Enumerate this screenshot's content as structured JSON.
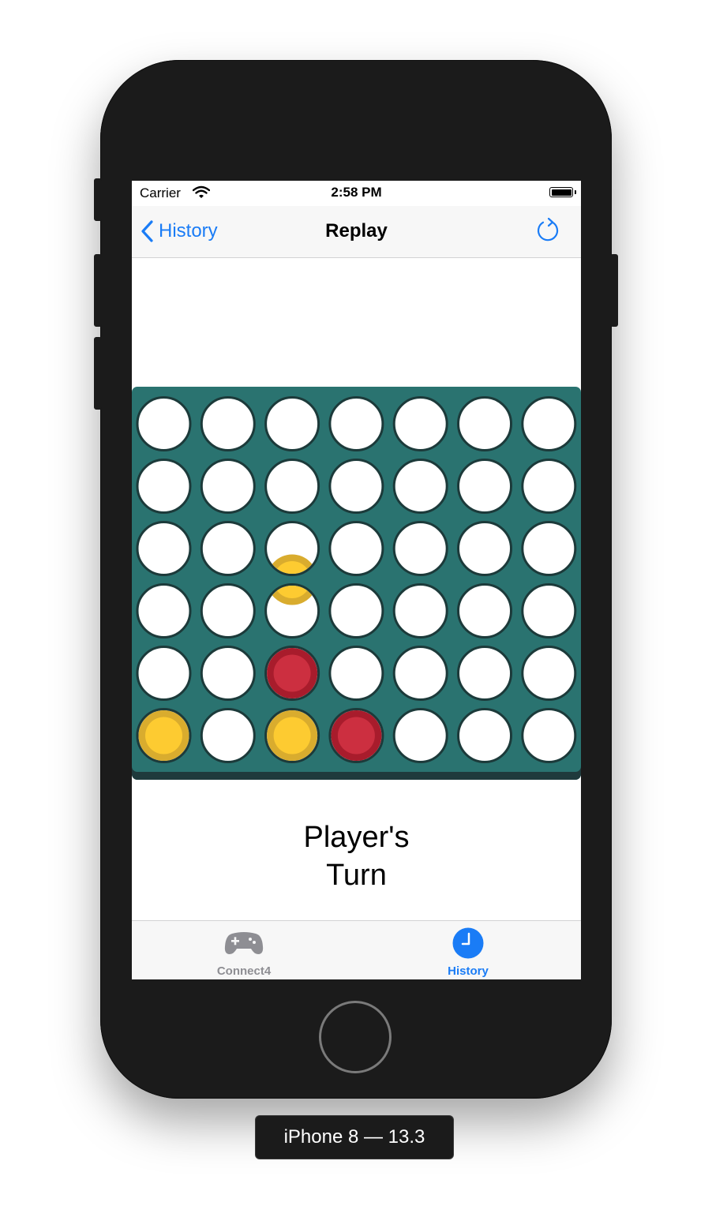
{
  "status_bar": {
    "carrier": "Carrier",
    "time": "2:58 PM"
  },
  "nav": {
    "back_label": "History",
    "title": "Replay"
  },
  "board": {
    "rows": 6,
    "cols": 7,
    "cells": [
      [
        "empty",
        "empty",
        "empty",
        "empty",
        "empty",
        "empty",
        "empty"
      ],
      [
        "empty",
        "empty",
        "empty",
        "empty",
        "empty",
        "empty",
        "empty"
      ],
      [
        "empty",
        "empty",
        "empty",
        "empty",
        "empty",
        "empty",
        "empty"
      ],
      [
        "empty",
        "empty",
        "empty",
        "empty",
        "empty",
        "empty",
        "empty"
      ],
      [
        "empty",
        "empty",
        "red",
        "empty",
        "empty",
        "empty",
        "empty"
      ],
      [
        "yellow",
        "empty",
        "yellow",
        "red",
        "empty",
        "empty",
        "empty"
      ]
    ],
    "falling_piece": {
      "color": "yellow",
      "column": 3,
      "row_position": 2.5
    },
    "colors": {
      "board": "#2a7370",
      "board_shadow": "#1f3a3c",
      "hole_border": "#1c3a3a",
      "empty": "#ffffff",
      "red_outer": "#a81c2c",
      "red_inner": "#cc2f40",
      "yellow_outer": "#d9ac2e",
      "yellow_inner": "#fdcb31"
    }
  },
  "turn_label": {
    "line1": "Player's",
    "line2": "Turn"
  },
  "tabs": [
    {
      "label": "Connect4",
      "icon": "gamecontroller-icon",
      "selected": false,
      "color": "#8e8e93"
    },
    {
      "label": "History",
      "icon": "clock-icon",
      "selected": true,
      "color": "#1a7cf6"
    }
  ],
  "device_label": "iPhone 8 — 13.3"
}
